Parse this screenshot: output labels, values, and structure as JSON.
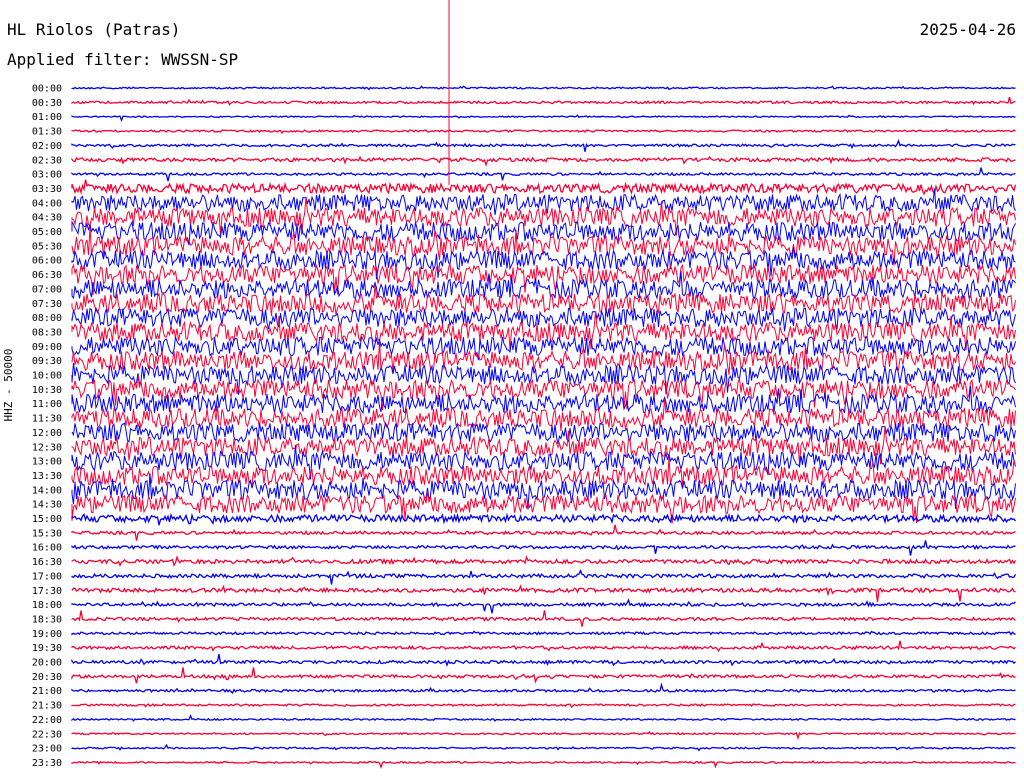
{
  "header": {
    "station": "HL Riolos (Patras)",
    "filter": "Applied filter: WWSSN-SP",
    "date": "2025-04-26"
  },
  "chart_data": {
    "type": "line",
    "title": "HL Riolos (Patras)",
    "ylabel": "HHZ - 50000",
    "trace_colors": [
      "#0000ff",
      "#ff0033"
    ],
    "marker_color": "#ff0033",
    "row_labels": [
      "00:00",
      "00:30",
      "01:00",
      "01:30",
      "02:00",
      "02:30",
      "03:00",
      "03:30",
      "04:00",
      "04:30",
      "05:00",
      "05:30",
      "06:00",
      "06:30",
      "07:00",
      "07:30",
      "08:00",
      "08:30",
      "09:00",
      "09:30",
      "10:00",
      "10:30",
      "11:00",
      "11:30",
      "12:00",
      "12:30",
      "13:00",
      "13:30",
      "14:00",
      "14:30",
      "15:00",
      "15:30",
      "16:00",
      "16:30",
      "17:00",
      "17:30",
      "18:00",
      "18:30",
      "19:00",
      "19:30",
      "20:00",
      "20:30",
      "21:00",
      "21:30",
      "22:00",
      "22:30",
      "23:00",
      "23:30"
    ],
    "amplitude": [
      0.08,
      0.12,
      0.06,
      0.1,
      0.12,
      0.18,
      0.12,
      0.45,
      0.85,
      0.95,
      0.95,
      0.95,
      0.95,
      0.95,
      0.95,
      0.95,
      0.95,
      0.95,
      0.95,
      0.95,
      0.95,
      0.95,
      0.95,
      0.95,
      0.95,
      0.95,
      0.95,
      0.95,
      0.95,
      0.9,
      0.35,
      0.15,
      0.15,
      0.2,
      0.18,
      0.2,
      0.15,
      0.15,
      0.12,
      0.15,
      0.15,
      0.15,
      0.12,
      0.1,
      0.08,
      0.08,
      0.08,
      0.08
    ]
  }
}
